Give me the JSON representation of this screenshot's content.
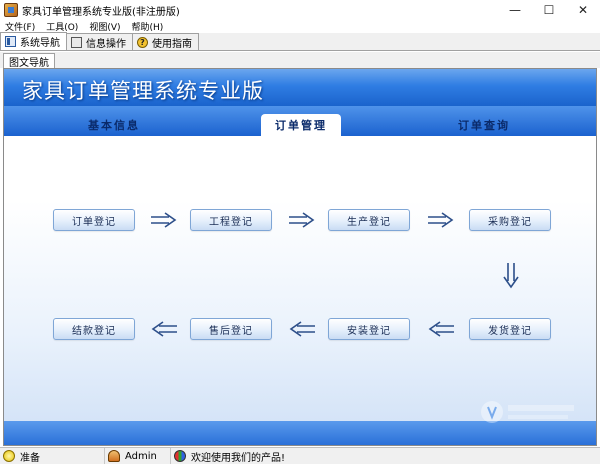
{
  "window": {
    "title": "家具订单管理系统专业版(非注册版)",
    "minimize_glyph": "—",
    "maximize_glyph": "☐",
    "close_glyph": "✕"
  },
  "menu": [
    "文件(F)",
    "工具(O)",
    "视图(V)",
    "帮助(H)"
  ],
  "tool_tabs": [
    {
      "label": "系统导航",
      "icon": "nav-icon"
    },
    {
      "label": "信息操作",
      "icon": "info-icon"
    },
    {
      "label": "使用指南",
      "icon": "help-icon",
      "icon_glyph": "?"
    }
  ],
  "sub_tab": "图文导航",
  "banner": {
    "title": "家具订单管理系统专业版"
  },
  "nav_tabs": [
    "基本信息",
    "订单管理",
    "订单查询"
  ],
  "active_nav_tab": "订单管理",
  "flow": {
    "row1": [
      "订单登记",
      "工程登记",
      "生产登记",
      "采购登记"
    ],
    "row2": [
      "结款登记",
      "售后登记",
      "安装登记",
      "发货登记"
    ]
  },
  "status": {
    "ready": "准备",
    "user": "Admin",
    "message": "欢迎使用我们的产品!"
  },
  "colors": {
    "banner_blue": "#2f7de3",
    "nav_text": "#0a2a6a",
    "button_border": "#7fa6d6",
    "arrow": "#2d4f8a"
  }
}
